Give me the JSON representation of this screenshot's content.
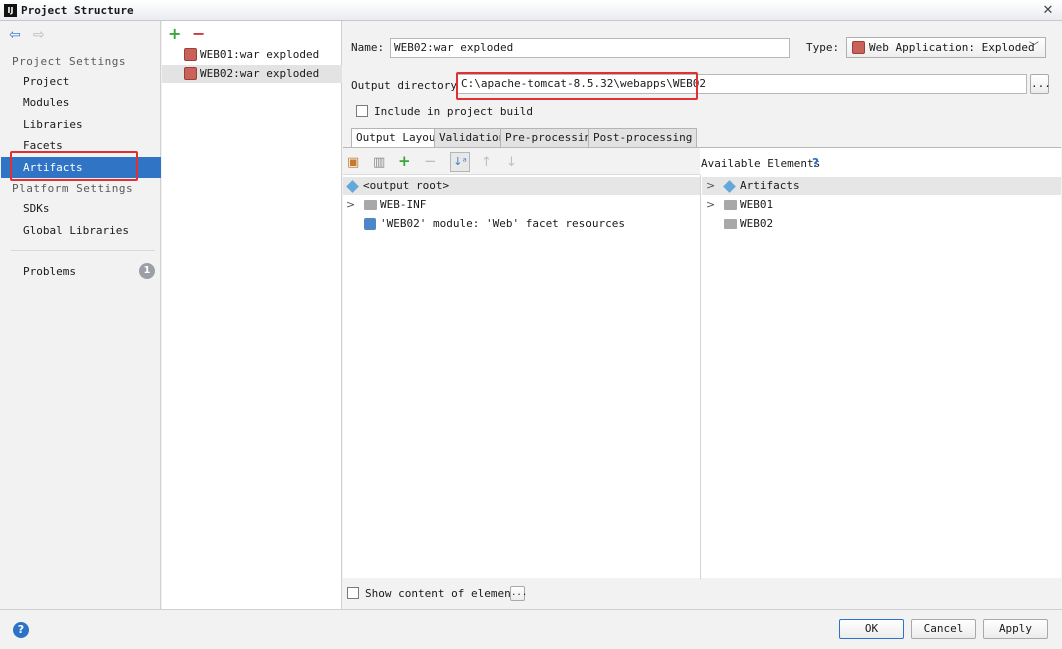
{
  "window": {
    "logo": "IJ",
    "title": "Project Structure",
    "close": "✕"
  },
  "sidebar": {
    "back": "⇦",
    "forward": "⇨",
    "project_settings": "Project Settings",
    "items": [
      "Project",
      "Modules",
      "Libraries",
      "Facets",
      "Artifacts"
    ],
    "platform_settings": "Platform Settings",
    "platform_items": [
      "SDKs",
      "Global Libraries"
    ],
    "problems": "Problems",
    "problems_count": "1"
  },
  "artifacts": {
    "add": "+",
    "remove": "−",
    "list": [
      "WEB01:war exploded",
      "WEB02:war exploded"
    ]
  },
  "form": {
    "name_label": "Name:",
    "name_value": "WEB02:war exploded",
    "type_label": "Type:",
    "type_value": "Web Application: Exploded",
    "output_label": "Output directory:",
    "output_value": "C:\\apache-tomcat-8.5.32\\webapps\\WEB02",
    "browse": "...",
    "include_label": "Include in project build"
  },
  "tabs": [
    "Output Layout",
    "Validation",
    "Pre-processing",
    "Post-processing"
  ],
  "layout": {
    "tree": [
      "<output root>",
      "WEB-INF",
      "'WEB02' module: 'Web' facet resources"
    ],
    "available_label": "Available Elements",
    "available_help": "?",
    "available": [
      "Artifacts",
      "WEB01",
      "WEB02"
    ],
    "show_content": "Show content of elements",
    "show_btn": "..."
  },
  "buttons": {
    "ok": "OK",
    "cancel": "Cancel",
    "apply": "Apply",
    "help": "?"
  },
  "colors": {
    "selection": "#2f74c5",
    "highlight_box": "#e03030",
    "add": "#3aa53a",
    "remove": "#d03434"
  }
}
